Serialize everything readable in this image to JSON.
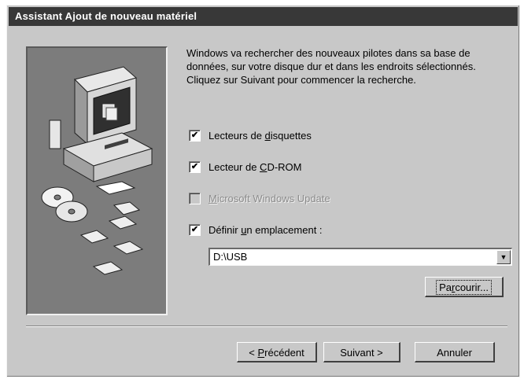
{
  "window": {
    "title": "Assistant Ajout de nouveau matériel"
  },
  "intro_text": "Windows va rechercher des nouveaux pilotes dans sa base de données, sur votre disque dur et dans les endroits sélectionnés. Cliquez sur Suivant pour commencer la recherche.",
  "options": [
    {
      "pre": "Lecteurs de ",
      "mnemonic": "d",
      "post": "isquettes",
      "checked": true,
      "enabled": true
    },
    {
      "pre": "Lecteur de ",
      "mnemonic": "C",
      "post": "D-ROM",
      "checked": true,
      "enabled": true
    },
    {
      "pre": "",
      "mnemonic": "M",
      "post": "icrosoft Windows Update",
      "checked": false,
      "enabled": false
    },
    {
      "pre": "Définir ",
      "mnemonic": "u",
      "post": "n emplacement :",
      "checked": true,
      "enabled": true
    }
  ],
  "location_value": "D:\\USB",
  "buttons": {
    "browse": {
      "pre": "Pa",
      "mnemonic": "r",
      "post": "courir..."
    },
    "back": {
      "pre": "< ",
      "mnemonic": "P",
      "post": "récédent"
    },
    "next": "Suivant >",
    "cancel": "Annuler"
  },
  "check_mark": "✔",
  "colors": {
    "titlebar": "#383838",
    "dialog": "#c8c8c8",
    "panel": "#7c7c7c"
  }
}
